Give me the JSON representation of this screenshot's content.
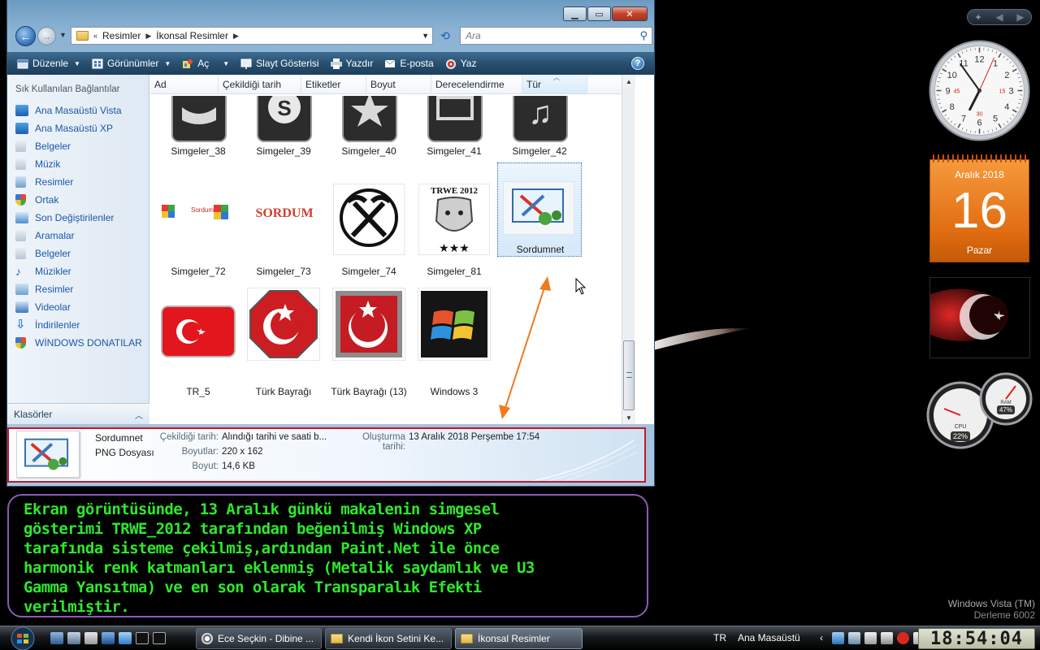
{
  "window": {
    "breadcrumb": [
      "Resimler",
      "İkonsal Resimler"
    ],
    "search_placeholder": "Ara"
  },
  "toolbar": {
    "items": [
      "Düzenle",
      "Görünümler",
      "Aç",
      "Slayt Gösterisi",
      "Yazdır",
      "E-posta",
      "Yaz"
    ]
  },
  "nav_pane": {
    "title": "Sık Kullanılan Bağlantılar",
    "items": [
      "Ana Masaüstü Vista",
      "Ana Masaüstü XP",
      "Belgeler",
      "Müzik",
      "Resimler",
      "Ortak",
      "Son Değiştirilenler",
      "Aramalar",
      "Belgeler",
      "Müzikler",
      "Resimler",
      "Videolar",
      "İndirilenler",
      "WİNDOWS DONATILAR"
    ],
    "folders_label": "Klasörler"
  },
  "columns": [
    "Ad",
    "Çekildiği tarih",
    "Etiketler",
    "Boyut",
    "Derecelendirme",
    "Tür"
  ],
  "files": [
    {
      "name": "Simgeler_38"
    },
    {
      "name": "Simgeler_39"
    },
    {
      "name": "Simgeler_40"
    },
    {
      "name": "Simgeler_41"
    },
    {
      "name": "Simgeler_42"
    },
    {
      "name": "Simgeler_72"
    },
    {
      "name": "Simgeler_73"
    },
    {
      "name": "Simgeler_74"
    },
    {
      "name": "Simgeler_81"
    },
    {
      "name": "Sordumnet",
      "selected": true
    },
    {
      "name": "TR_5"
    },
    {
      "name": "Türk Bayrağı"
    },
    {
      "name": "Türk Bayrağı (13)"
    },
    {
      "name": "Windows 3"
    }
  ],
  "thumb_text": {
    "trwe": "TRWE 2012",
    "sordum": "SORDUM",
    "sordum_small": "Sordum"
  },
  "details": {
    "name": "Sordumnet",
    "type": "PNG Dosyası",
    "date_taken_label": "Çekildiği tarih:",
    "date_taken_value": "Alındığı tarihi ve saati b...",
    "created_label": "Oluşturma tarihi:",
    "created_value": "13 Aralık 2018 Perşembe 17:54",
    "dimensions_label": "Boyutlar:",
    "dimensions_value": "220 x 162",
    "size_label": "Boyut:",
    "size_value": "14,6 KB"
  },
  "caption": {
    "lines": [
      "Ekran görüntüsünde, 13 Aralık günkü makalenin simgesel",
      "gösterimi TRWE_2012 tarafından beğenilmiş Windows XP",
      "tarafında sisteme çekilmiş,ardından Paint.Net ile önce",
      "harmonik renk katmanları eklenmiş (Metalik saydamlık ve U3",
      "Gamma Yansıtma) ve en son olarak Transparalık Efekti",
      "verilmiştir."
    ]
  },
  "sidebar": {
    "add_label": "+",
    "clock": {
      "numbers": [
        "12",
        "3",
        "6",
        "9",
        "1",
        "2",
        "4",
        "5",
        "7",
        "8",
        "10",
        "11"
      ],
      "red_numbers": [
        "15",
        "30",
        "45"
      ],
      "hour": 18,
      "minute": 54,
      "second": 4
    },
    "calendar": {
      "month": "Aralık 2018",
      "day": "16",
      "weekday": "Pazar"
    },
    "gauges": {
      "cpu_label": "CPU",
      "cpu_value": "22%",
      "ram_label": "RAM",
      "ram_value": "47%"
    }
  },
  "branding": {
    "line1": "Windows Vista (TM)",
    "line2": "Derleme 6002"
  },
  "taskbar": {
    "buttons": [
      "Ece Seçkin - Dibine ...",
      "Kendi İkon Setini Ke...",
      "İkonsal Resimler"
    ],
    "language": "TR",
    "desktop_label": "Ana Masaüstü",
    "time": "18:54:04"
  }
}
